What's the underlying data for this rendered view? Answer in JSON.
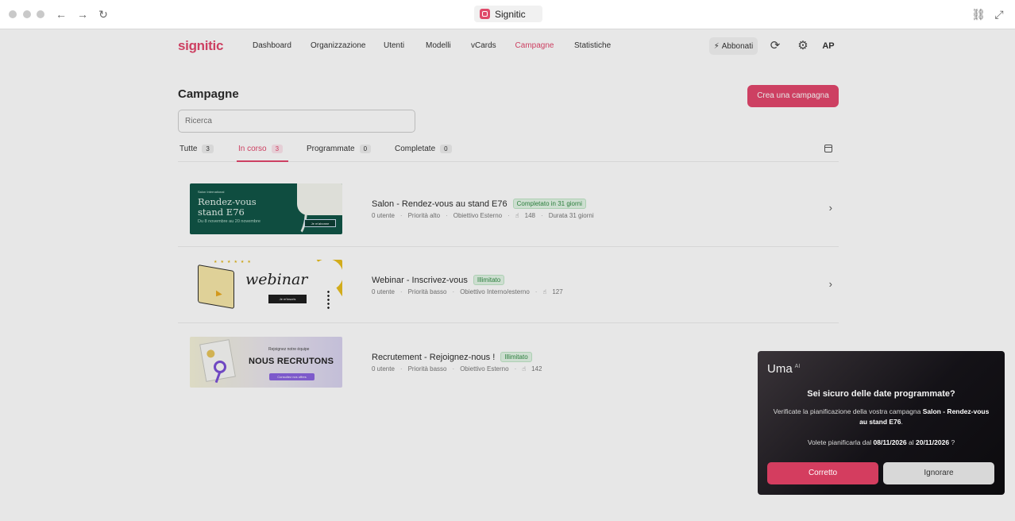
{
  "browser": {
    "tab_title": "Signitic"
  },
  "header": {
    "logo": "signitic",
    "nav": [
      "Dashboard",
      "Organizzazione",
      "Utenti",
      "Modelli",
      "vCards",
      "Campagne",
      "Statistiche"
    ],
    "active_nav": "Campagne",
    "subscribe_label": "Abbonati",
    "avatar_initials": "AP"
  },
  "page": {
    "title": "Campagne",
    "create_button": "Crea una campagna",
    "search_placeholder": "Ricerca"
  },
  "filters": [
    {
      "label": "Tutte",
      "count": "3"
    },
    {
      "label": "In corso",
      "count": "3"
    },
    {
      "label": "Programmate",
      "count": "0"
    },
    {
      "label": "Completate",
      "count": "0"
    }
  ],
  "campaigns": [
    {
      "title": "Salon - Rendez-vous au stand E76",
      "badge": "Completato in 31 giorni",
      "meta": [
        "0 utente",
        "Priorità alto",
        "Obiettivo Esterno",
        "148",
        "Durata 31 giorni"
      ],
      "thumb": {
        "small": "Salon International",
        "big_1": "Rendez-vous",
        "big_2": "stand E76",
        "date": "Du 8 novembre au 20 novembre",
        "button": "Je m'abonne"
      }
    },
    {
      "title": "Webinar - Inscrivez-vous",
      "badge": "Illimitato",
      "meta": [
        "0 utente",
        "Priorità basso",
        "Obiettivo Interno/esterno",
        "127"
      ],
      "thumb": {
        "word": "webinar",
        "button": "Je m'inscris"
      }
    },
    {
      "title": "Recrutement - Rejoignez-nous !",
      "badge": "Illimitato",
      "meta": [
        "0 utente",
        "Priorità basso",
        "Obiettivo Esterno",
        "142"
      ],
      "thumb": {
        "small": "Rejoignez notre équipe",
        "big": "NOUS RECRUTONS",
        "button": "Consultez nos offres"
      }
    }
  ],
  "uma": {
    "title": "Uma",
    "title_sup": "AI",
    "question": "Sei sicuro delle date programmate?",
    "body_pre": "Verificate la pianificazione della vostra campagna",
    "body_campaign": "Salon - Rendez-vous au stand E76",
    "body_post": ".",
    "q2_pre": "Volete pianificarla dal",
    "date_from": "08/11/2026",
    "q2_mid": "al",
    "date_to": "20/11/2026",
    "q2_post": "?",
    "confirm_button": "Corretto",
    "ignore_button": "Ignorare"
  }
}
